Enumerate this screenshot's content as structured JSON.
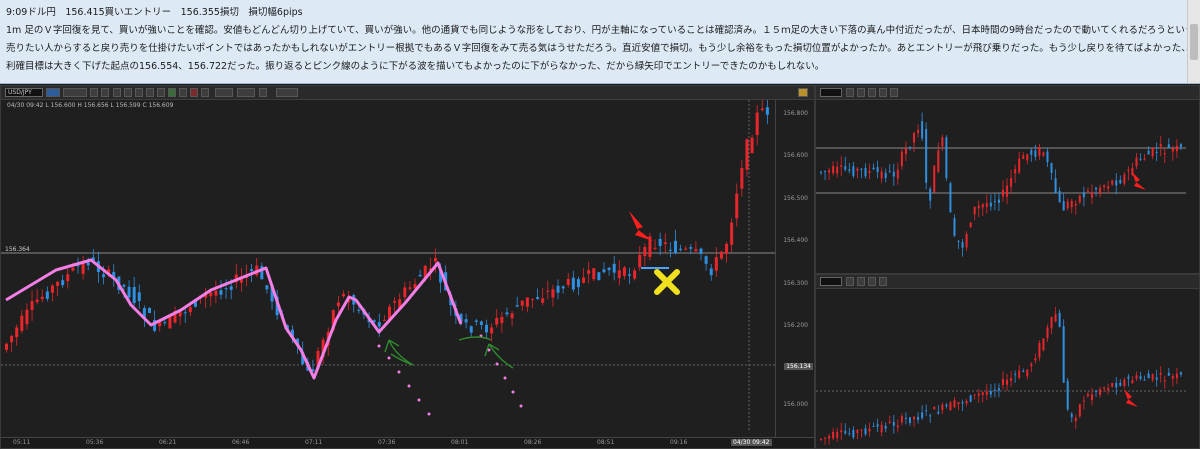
{
  "notes": {
    "line1": "9:09ドル円　156.415買いエントリー　156.355損切　損切幅6pips",
    "line2": "1m 足のＶ字回復を見て、買いが強いことを確認。安値もどんどん切り上げていて、買いが強い。他の通貨でも同じような形をしており、円が主軸になっていることは確認済み。１５ｍ足の大きい下落の真ん中付近だったが、日本時間の9時台だったので動いてくれるだろうというのもエントリーの理由",
    "line3": "売りたい人からすると戻り売りを仕掛けたいポイントではあったかもしれないがエントリー根拠でもあるＶ字回復をみて売る気はうせただろう。直近安値で損切。もう少し余裕をもった損切位置がよかったか。あとエントリーが飛び乗りだった。もう少し戻りを待てばよかった、、キタコレ！っと思ってエントリーしてしまった。。",
    "line4": "利確目標は大きく下げた起点の156.554、156.722だった。振り返るとピンク線のように下がる波を描いてもよかったのに下がらなかった、だから緑矢印でエントリーできたのかもしれない。"
  },
  "main_chart": {
    "symbol": "USD/JPY",
    "ohlc": "04/30 09:42   L 156.600   H 156.656   L 156.599   C 156.609",
    "price_labels": [
      "156.800",
      "156.600",
      "156.500",
      "156.400",
      "156.300",
      "156.200",
      "156.100",
      "156.000"
    ],
    "time_labels": [
      "05:11",
      "05:36",
      "06:21",
      "06:46",
      "07:11",
      "07:36",
      "08:01",
      "08:26",
      "08:51",
      "09:16"
    ],
    "current_time": "04/30 09:42",
    "hline_label": "156.364",
    "flag_price": "156.134",
    "colors": {
      "up": "#e8262b",
      "down": "#2f8fe0",
      "pink": "#f27ee6",
      "green": "#2e8b2e",
      "yellow": "#f0e020"
    }
  },
  "side_chart_top": {
    "symbol": "USD/JPY 15m",
    "hline_labels": [
      "157.0",
      "156.4"
    ]
  },
  "side_chart_bottom": {
    "symbol": "USD/JPY 1h"
  }
}
